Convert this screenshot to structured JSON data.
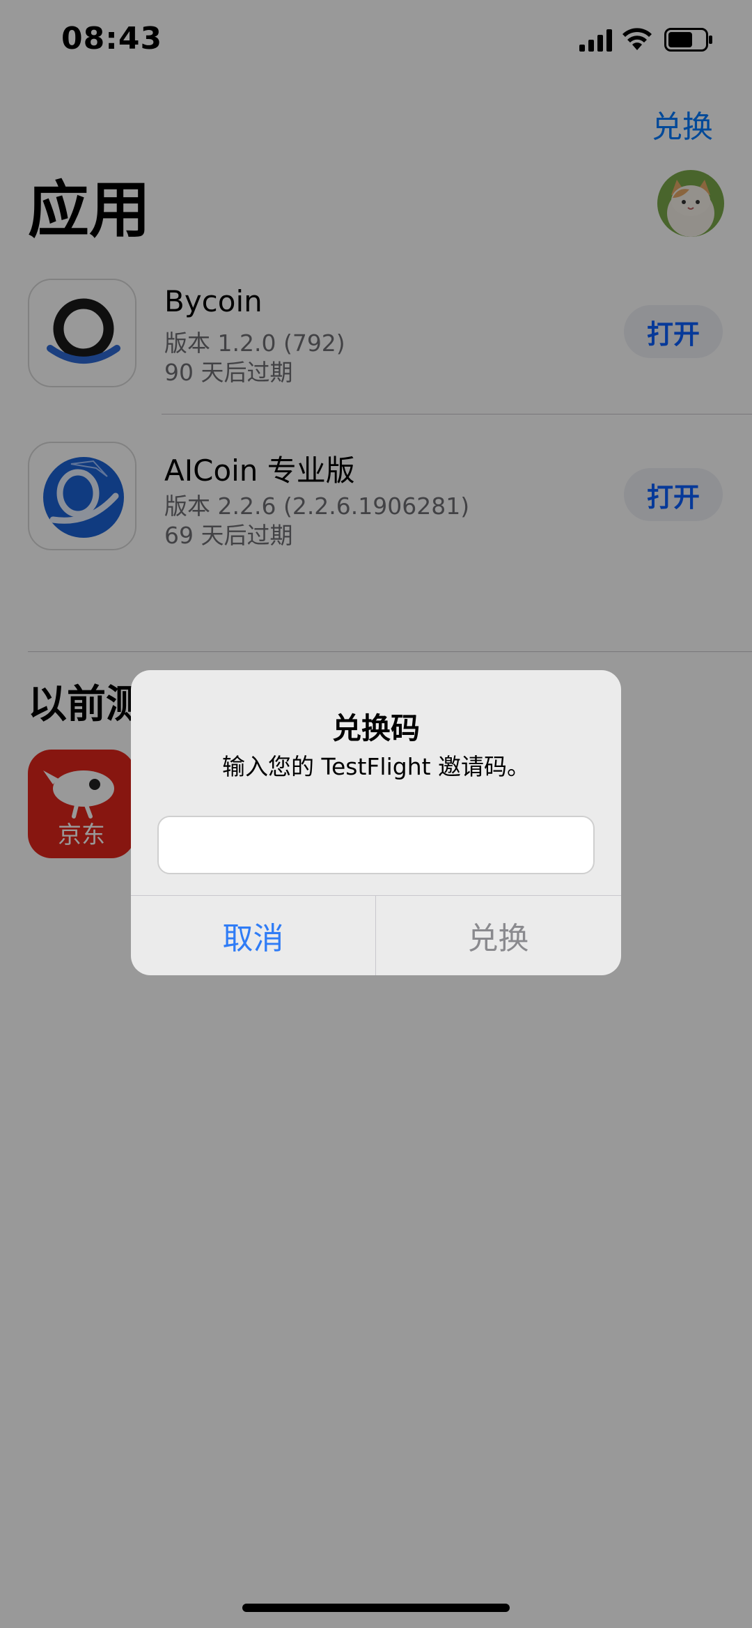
{
  "status_bar": {
    "time": "08:43"
  },
  "nav": {
    "redeem_label": "兑换"
  },
  "page": {
    "title": "应用"
  },
  "apps": [
    {
      "name": "Bycoin",
      "version": "版本 1.2.0 (792)",
      "expires": "90 天后过期",
      "action": "打开"
    },
    {
      "name": "AICoin 专业版",
      "version": "版本 2.2.6 (2.2.6.1906281)",
      "expires": "69 天后过期",
      "action": "打开"
    }
  ],
  "previous_section": {
    "title": "以前测试",
    "first_app_icon_label": "京东"
  },
  "alert": {
    "title": "兑换码",
    "message": "输入您的 TestFlight 邀请码。",
    "input_value": "",
    "input_placeholder": "",
    "cancel_label": "取消",
    "redeem_label": "兑换"
  },
  "colors": {
    "accent": "#007aff",
    "cancel": "#2f7cf6",
    "disabled": "#8a8a8e",
    "jd_red": "#e1251b"
  }
}
